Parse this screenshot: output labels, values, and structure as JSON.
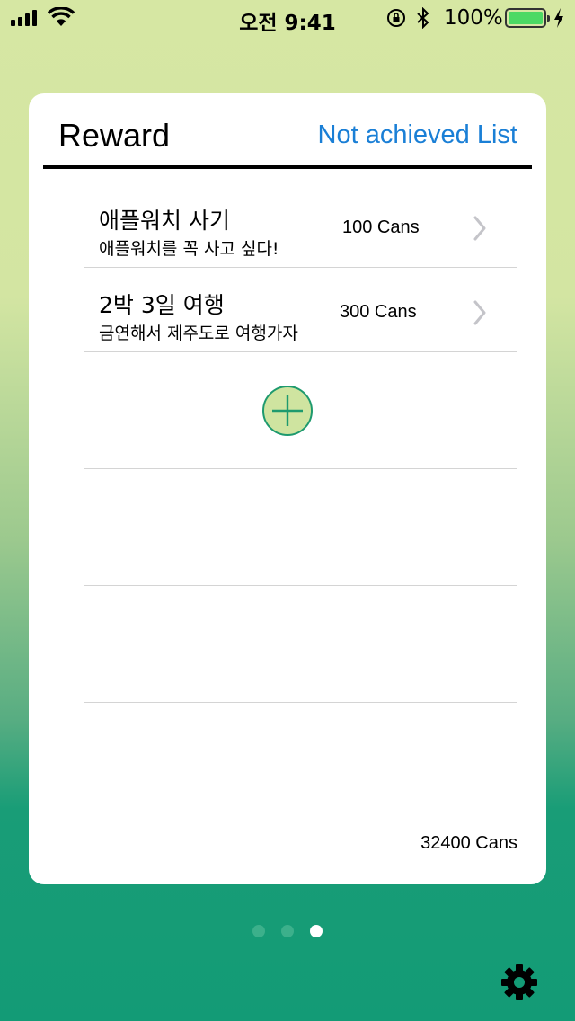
{
  "status_bar": {
    "time": "오전 9:41",
    "battery_percent": "100%",
    "battery_level": 1.0,
    "battery_color": "#4cd964"
  },
  "card": {
    "title": "Reward",
    "link_label": "Not achieved List",
    "link_color": "#1a7fd6",
    "rewards": [
      {
        "title": "애플워치 사기",
        "subtitle": "애플워치를 꼭 사고 싶다!",
        "amount": "100 Cans"
      },
      {
        "title": "2박 3일 여행",
        "subtitle": "금연해서 제주도로 여행가자",
        "amount": "300 Cans"
      }
    ],
    "add_icon": "plus-circle-icon",
    "total": "32400 Cans"
  },
  "page_control": {
    "pages": 3,
    "current": 3
  },
  "settings_icon": "gear-icon"
}
